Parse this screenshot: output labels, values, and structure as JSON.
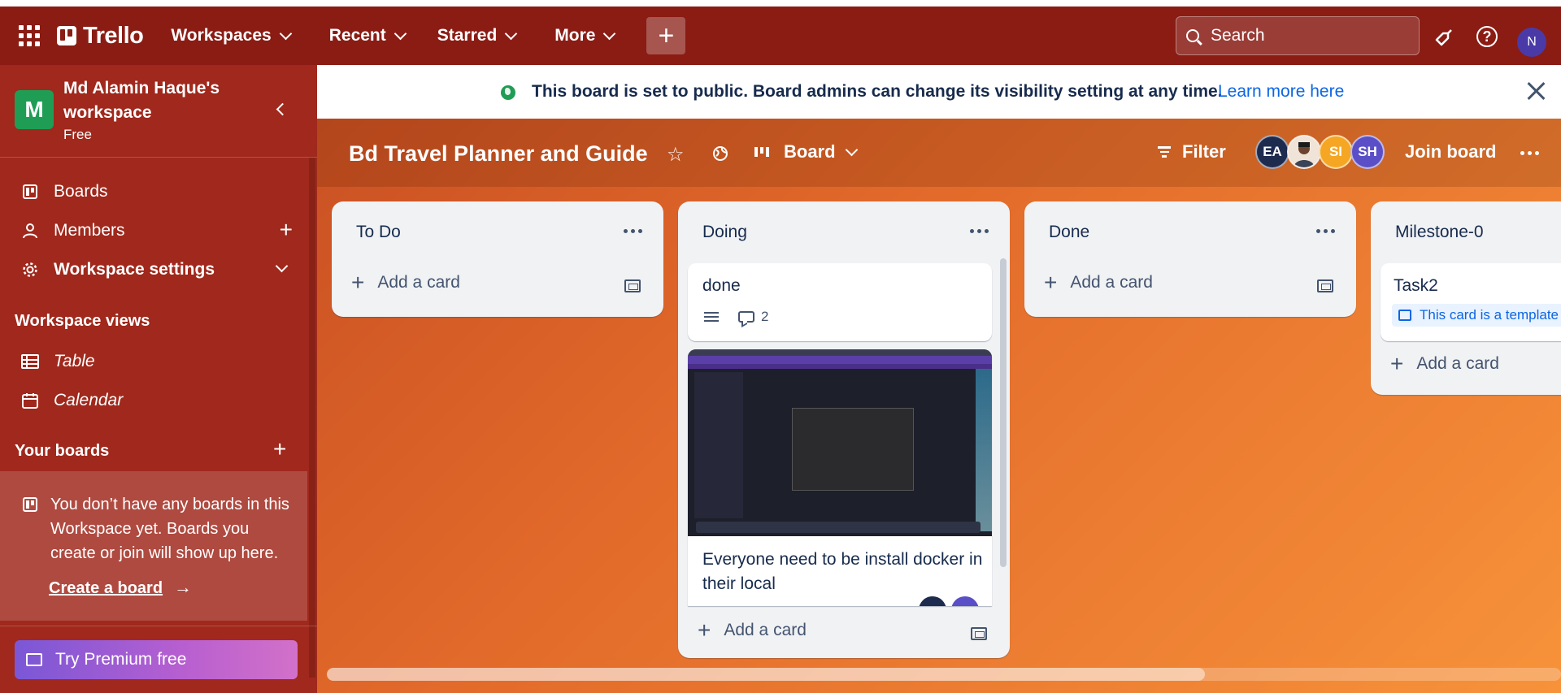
{
  "topbar": {
    "logo_text": "Trello",
    "nav": [
      "Workspaces",
      "Recent",
      "Starred",
      "More"
    ],
    "create_label": "+",
    "search_placeholder": "Search",
    "help_label": "?",
    "user_initial": "N"
  },
  "sidebar": {
    "workspace_initial": "M",
    "workspace_name": "Md Alamin Haque's workspace",
    "workspace_plan": "Free",
    "items": [
      {
        "label": "Boards",
        "icon": "board-icon"
      },
      {
        "label": "Members",
        "icon": "person-icon"
      },
      {
        "label": "Workspace settings",
        "icon": "gear-icon"
      }
    ],
    "views_title": "Workspace views",
    "views": [
      {
        "label": "Table",
        "icon": "table-icon"
      },
      {
        "label": "Calendar",
        "icon": "calendar-icon"
      }
    ],
    "your_boards_title": "Your boards",
    "empty_message": "You don’t have any boards in this Workspace yet. Boards you create or join will show up here.",
    "create_board_link": "Create a board",
    "premium_label": "Try Premium free"
  },
  "banner": {
    "message": "This board is set to public. Board admins can change its visibility setting at any time.",
    "link": "Learn more here"
  },
  "board": {
    "title": "Bd Travel Planner and Guide",
    "view_label": "Board",
    "filter_label": "Filter",
    "members": [
      {
        "initials": "EA",
        "color": "#1d2b4f"
      },
      {
        "initials": "",
        "color": "#e8d3c0"
      },
      {
        "initials": "SI",
        "color": "#f5a623"
      },
      {
        "initials": "SH",
        "color": "#5b4fc7"
      }
    ],
    "join_label": "Join board"
  },
  "lists": [
    {
      "title": "To Do",
      "add_card": "Add a card"
    },
    {
      "title": "Doing",
      "add_card": "Add a card",
      "cards": [
        {
          "title": "done",
          "comments": "2"
        },
        {
          "title": "Everyone need to be install docker in their local"
        }
      ]
    },
    {
      "title": "Done",
      "add_card": "Add a card"
    },
    {
      "title": "Milestone-0",
      "add_card": "Add a card",
      "cards": [
        {
          "title": "Task2",
          "badge": "This card is a template"
        }
      ]
    }
  ],
  "colors": {
    "topbar": "#8a1c14",
    "sidebar": "#a0281c",
    "accent_link": "#0c66e4",
    "public_green": "#1f9d55"
  }
}
